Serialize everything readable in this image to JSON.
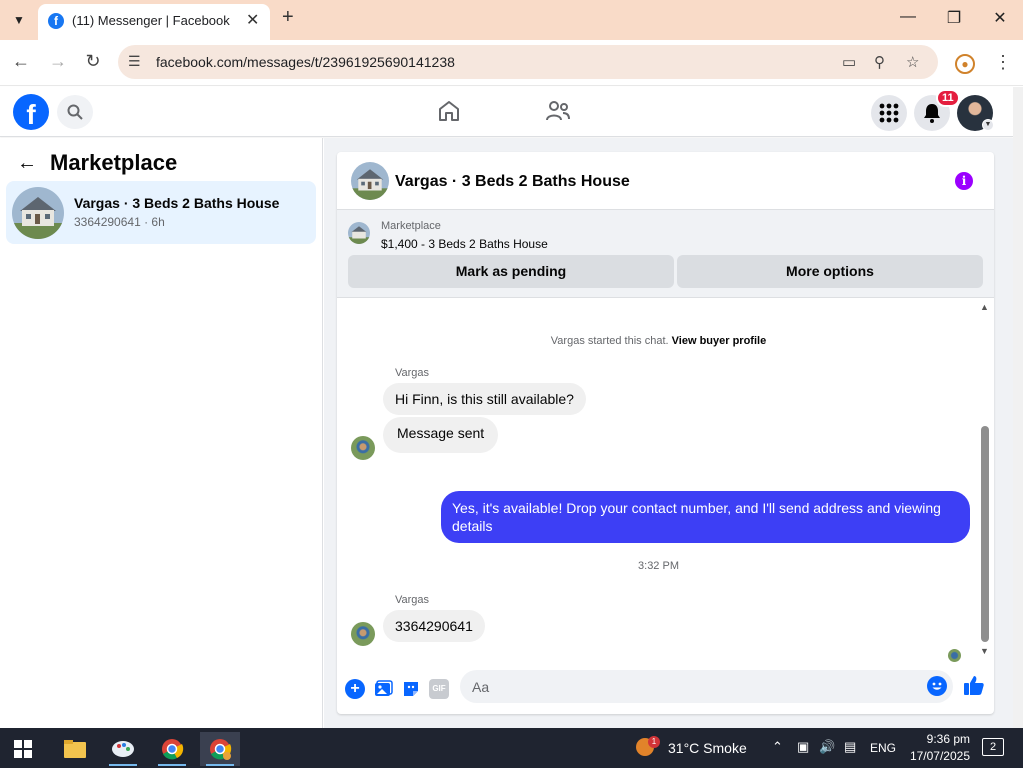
{
  "browser": {
    "tab_title": "(11) Messenger | Facebook",
    "url": "facebook.com/messages/t/23961925690141238"
  },
  "fb_nav": {
    "notification_count": "11"
  },
  "left_panel": {
    "title": "Marketplace",
    "conversation": {
      "title": "Vargas · 3 Beds 2 Baths House",
      "subtitle": "3364290641 · 6h"
    }
  },
  "chat": {
    "header_title": "Vargas · 3 Beds 2 Baths House",
    "listing": {
      "category": "Marketplace",
      "price_title": "$1,400 - 3 Beds 2 Baths House",
      "pending_button": "Mark as pending",
      "more_button": "More options"
    },
    "system_text": "Vargas started this chat.",
    "system_link": "View buyer profile",
    "messages": [
      {
        "sender": "Vargas",
        "text": "Hi Finn, is this still available?"
      },
      {
        "text": "Message sent"
      },
      {
        "text": "Yes, it's available! Drop your contact number, and I'll send address and viewing details"
      },
      {
        "sender": "Vargas",
        "text": "3364290641"
      }
    ],
    "timestamp": "3:32 PM",
    "composer_placeholder": "Aa",
    "gif_label": "GIF"
  },
  "taskbar": {
    "weather_badge": "1",
    "weather": "31°C  Smoke",
    "language": "ENG",
    "time": "9:36 pm",
    "date": "17/07/2025",
    "notification_count": "2"
  },
  "colors": {
    "accent": "#0866ff",
    "outgoing_bubble": "#3d3ff5",
    "selected_item": "#e7f3ff",
    "tab_strip": "#f9dbc8"
  }
}
